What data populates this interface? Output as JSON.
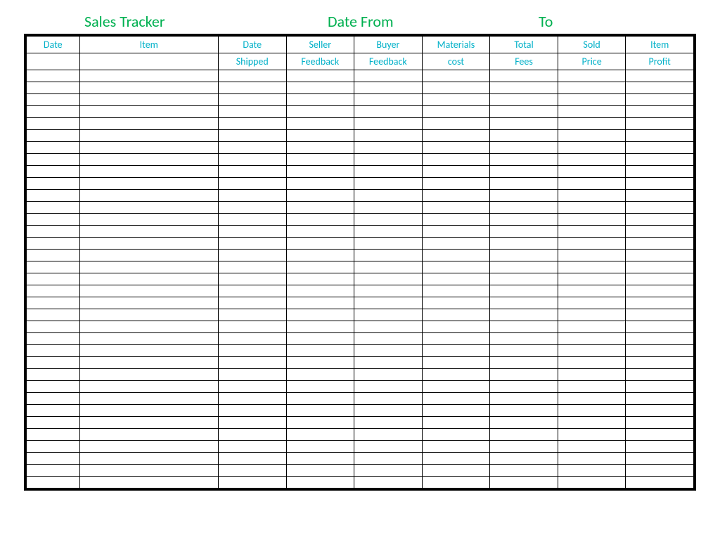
{
  "title": {
    "main": "Sales Tracker",
    "date_from_label": "Date From",
    "to_label": "To"
  },
  "headers": {
    "row1": {
      "date": "Date",
      "item": "Item",
      "date_shipped": "Date",
      "seller": "Seller",
      "buyer": "Buyer",
      "materials": "Materials",
      "total": "Total",
      "sold": "Sold",
      "item_profit": "Item"
    },
    "row2": {
      "date": "",
      "item": "",
      "date_shipped": "Shipped",
      "seller": "Feedback",
      "buyer": "Feedback",
      "materials": "cost",
      "total": "Fees",
      "sold": "Price",
      "item_profit": "Profit"
    }
  },
  "row_count": 35
}
